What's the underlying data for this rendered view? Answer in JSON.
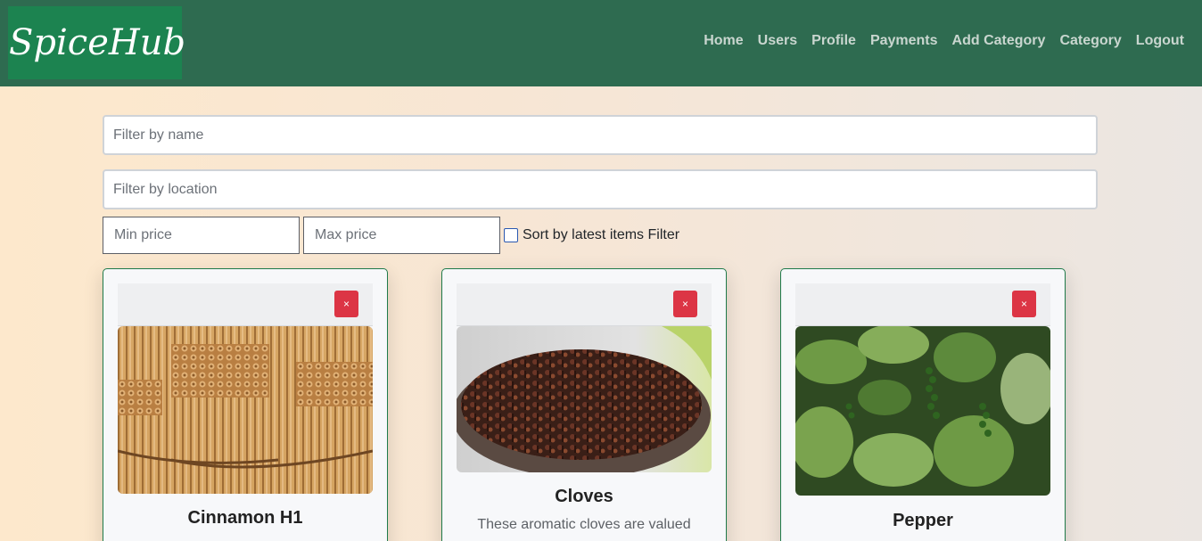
{
  "brand": {
    "name": "SpiceHub"
  },
  "nav": {
    "items": [
      {
        "label": "Home"
      },
      {
        "label": "Users"
      },
      {
        "label": "Profile"
      },
      {
        "label": "Payments"
      },
      {
        "label": "Add Category"
      },
      {
        "label": "Category"
      },
      {
        "label": "Logout"
      }
    ]
  },
  "filters": {
    "name_placeholder": "Filter by name",
    "location_placeholder": "Filter by location",
    "min_price_placeholder": "Min price",
    "max_price_placeholder": "Max price",
    "sort_label": "Sort by latest items Filter",
    "sort_checked": false
  },
  "products": [
    {
      "name": "Cinnamon H1",
      "delete_label": "×",
      "image": "cinnamon-sticks",
      "description": ""
    },
    {
      "name": "Cloves",
      "delete_label": "×",
      "image": "cloves",
      "description": "These aromatic cloves are valued"
    },
    {
      "name": "Pepper",
      "delete_label": "×",
      "image": "pepper-plant",
      "description": ""
    }
  ],
  "colors": {
    "navbar": "#2e6b50",
    "logo_bg": "#1c8350",
    "nav_link": "#c9d6cf",
    "delete": "#dc3545",
    "card_border": "#1f7a4a"
  }
}
